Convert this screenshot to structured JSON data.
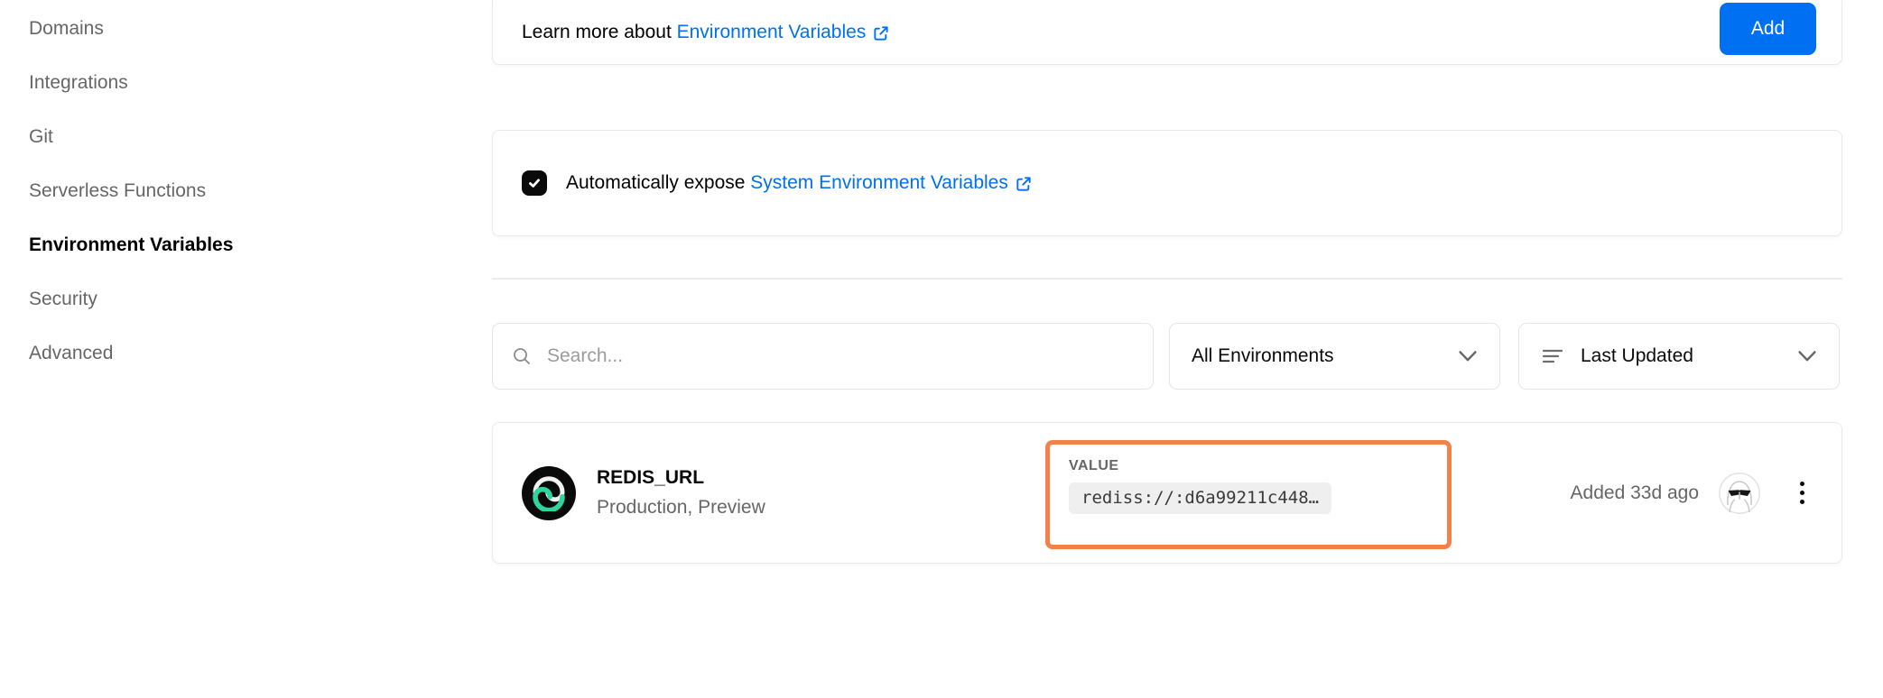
{
  "sidebar": {
    "items": [
      "Domains",
      "Integrations",
      "Git",
      "Serverless Functions",
      "Environment Variables",
      "Security",
      "Advanced"
    ],
    "active_item": "Environment Variables"
  },
  "learn_card": {
    "prefix": "Learn more about ",
    "link_label": "Environment Variables",
    "add_button": "Add"
  },
  "expose_card": {
    "checked": true,
    "prefix": "Automatically expose ",
    "link_label": "System Environment Variables"
  },
  "filters": {
    "search_placeholder": "Search...",
    "environment_selected": "All Environments",
    "sort_selected": "Last Updated"
  },
  "env_row": {
    "name": "REDIS_URL",
    "environments": "Production, Preview",
    "value_label": "VALUE",
    "value": "rediss://:d6a99211c448…",
    "added": "Added 33d ago"
  },
  "icons": {
    "external_link": "↗",
    "chevron_down": "⌄",
    "search": "⌕",
    "sort": "≡",
    "kebab": "⋮",
    "check": "✓",
    "integration_logo": "green-spiral-on-black",
    "avatar": "sunglasses-cartoon"
  },
  "colors": {
    "accent_blue": "#0070f3",
    "highlight_orange": "#f2814a",
    "logo_green": "#2fd39e",
    "muted_text": "#666666",
    "border": "#eaeaea"
  }
}
